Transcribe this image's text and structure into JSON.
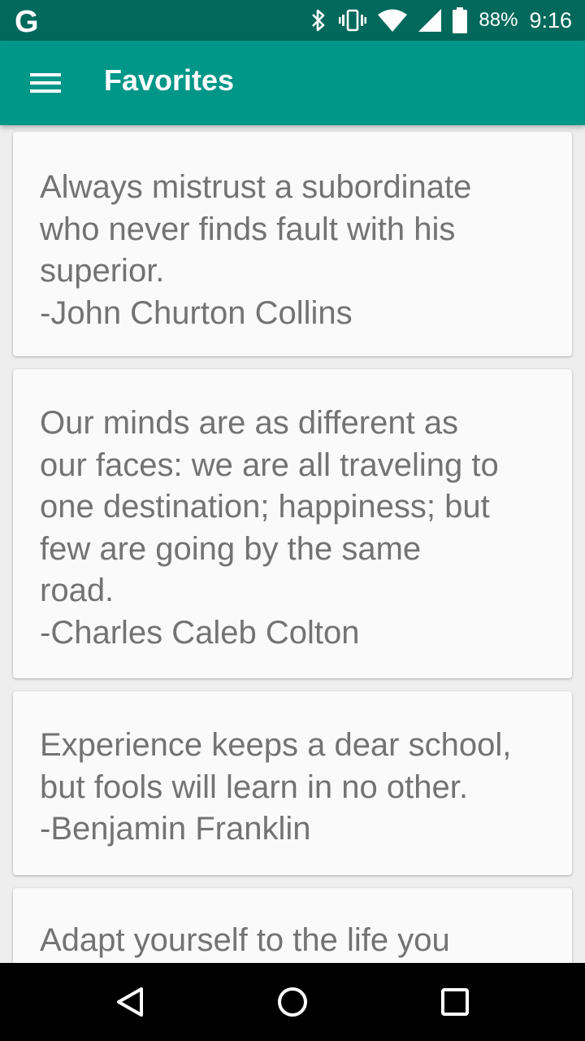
{
  "status_bar": {
    "app_icon": "google-g-icon",
    "app_icon_text": "G",
    "icons": [
      "bluetooth-icon",
      "vibrate-icon",
      "wifi-icon",
      "cell-signal-icon",
      "battery-icon"
    ],
    "battery_percent": "88%",
    "time": "9:16"
  },
  "app_bar": {
    "menu_icon": "hamburger-menu-icon",
    "title": "Favorites",
    "color": "#009688"
  },
  "quotes": [
    {
      "text": "Always mistrust a subordinate\nwho never finds fault with his\nsuperior.\n-John Churton Collins"
    },
    {
      "text": "Our minds are as different as\nour faces: we are all traveling to\none destination; happiness; but\nfew are going by the same\nroad.\n-Charles Caleb Colton"
    },
    {
      "text": "Experience keeps a dear school,\nbut fools will learn in no other.\n-Benjamin Franklin"
    },
    {
      "text": "Adapt yourself to the life you"
    }
  ],
  "nav_bar": {
    "back_icon": "back-triangle-icon",
    "home_icon": "home-circle-icon",
    "recents_icon": "recents-square-icon"
  }
}
